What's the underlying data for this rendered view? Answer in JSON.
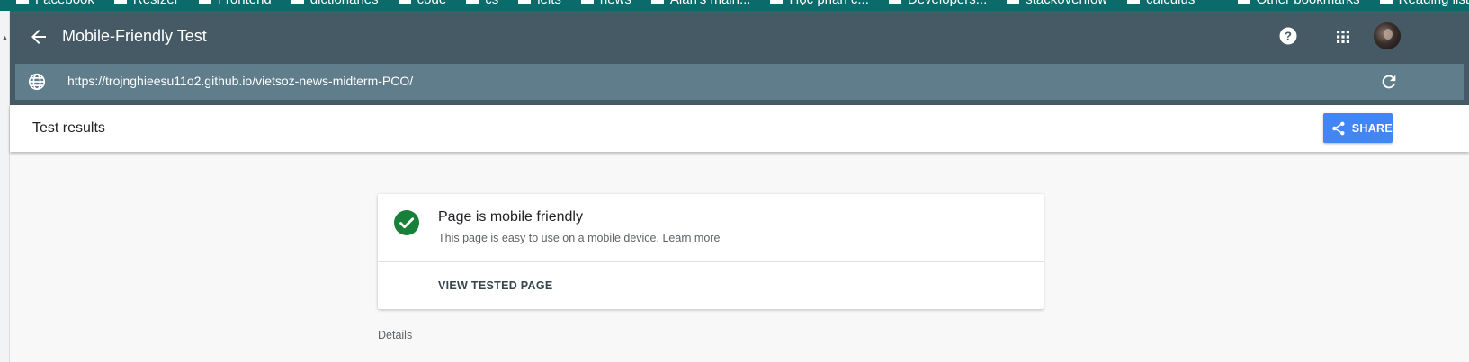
{
  "bookmarks": {
    "items": [
      "Facebook",
      "Resizer",
      "Frontend",
      "dictionaries",
      "code",
      "cs",
      "ielts",
      "news",
      "Alan's main...",
      "Học phần c...",
      "Developers...",
      "stackoverflow",
      "calculus"
    ],
    "right": [
      "Other bookmarks",
      "Reading list"
    ]
  },
  "header": {
    "title": "Mobile-Friendly Test",
    "url": "https://trojnghieesu11o2.github.io/vietsoz-news-midterm-PCO/"
  },
  "results": {
    "title": "Test results",
    "share_label": "SHARE"
  },
  "card": {
    "status_title": "Page is mobile friendly",
    "status_desc": "This page is easy to use on a mobile device.",
    "learn_more": "Learn more",
    "view_button": "VIEW TESTED PAGE"
  },
  "details_label": "Details",
  "colors": {
    "header_bg": "#455a64",
    "url_bg": "#607d8b",
    "share_bg": "#4285f4",
    "success": "#188038"
  }
}
